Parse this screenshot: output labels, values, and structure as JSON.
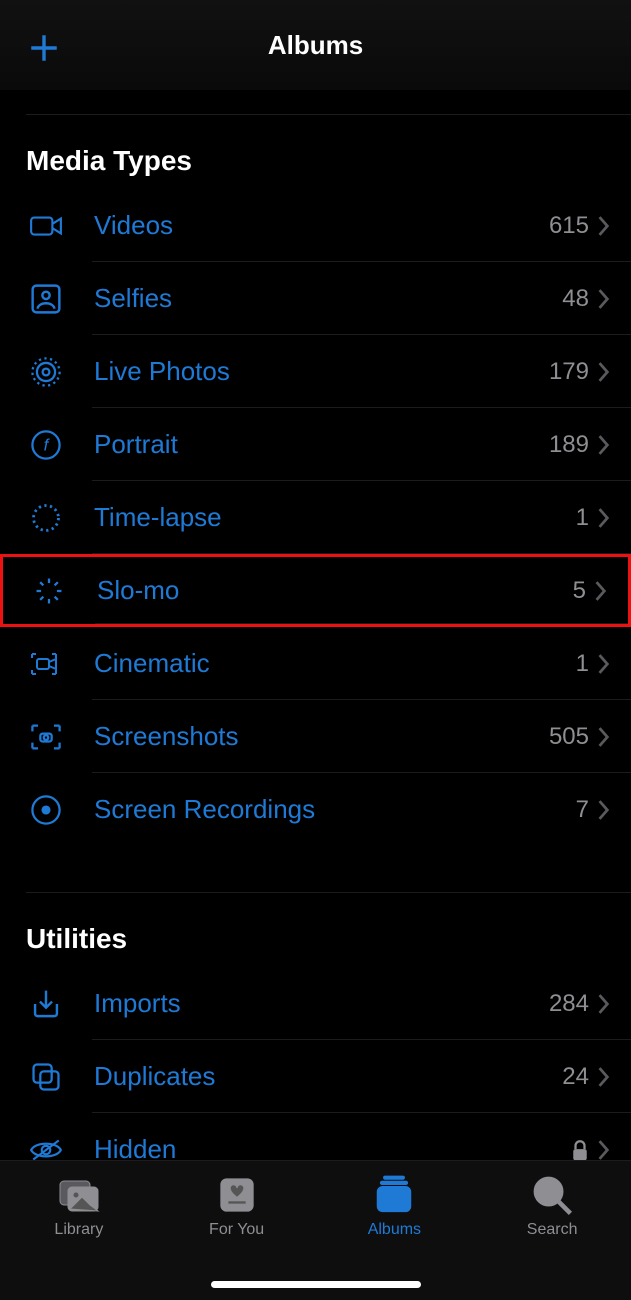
{
  "navbar": {
    "title": "Albums"
  },
  "sections": {
    "media": {
      "title": "Media Types",
      "rows": {
        "videos": {
          "label": "Videos",
          "count": "615"
        },
        "selfies": {
          "label": "Selfies",
          "count": "48"
        },
        "live": {
          "label": "Live Photos",
          "count": "179"
        },
        "portrait": {
          "label": "Portrait",
          "count": "189"
        },
        "timelapse": {
          "label": "Time-lapse",
          "count": "1"
        },
        "slomo": {
          "label": "Slo-mo",
          "count": "5"
        },
        "cinematic": {
          "label": "Cinematic",
          "count": "1"
        },
        "screenshots": {
          "label": "Screenshots",
          "count": "505"
        },
        "screenrec": {
          "label": "Screen Recordings",
          "count": "7"
        }
      }
    },
    "utilities": {
      "title": "Utilities",
      "rows": {
        "imports": {
          "label": "Imports",
          "count": "284"
        },
        "duplicates": {
          "label": "Duplicates",
          "count": "24"
        },
        "hidden": {
          "label": "Hidden"
        }
      }
    }
  },
  "tabbar": {
    "library": "Library",
    "foryou": "For You",
    "albums": "Albums",
    "search": "Search"
  },
  "highlighted": "slomo"
}
